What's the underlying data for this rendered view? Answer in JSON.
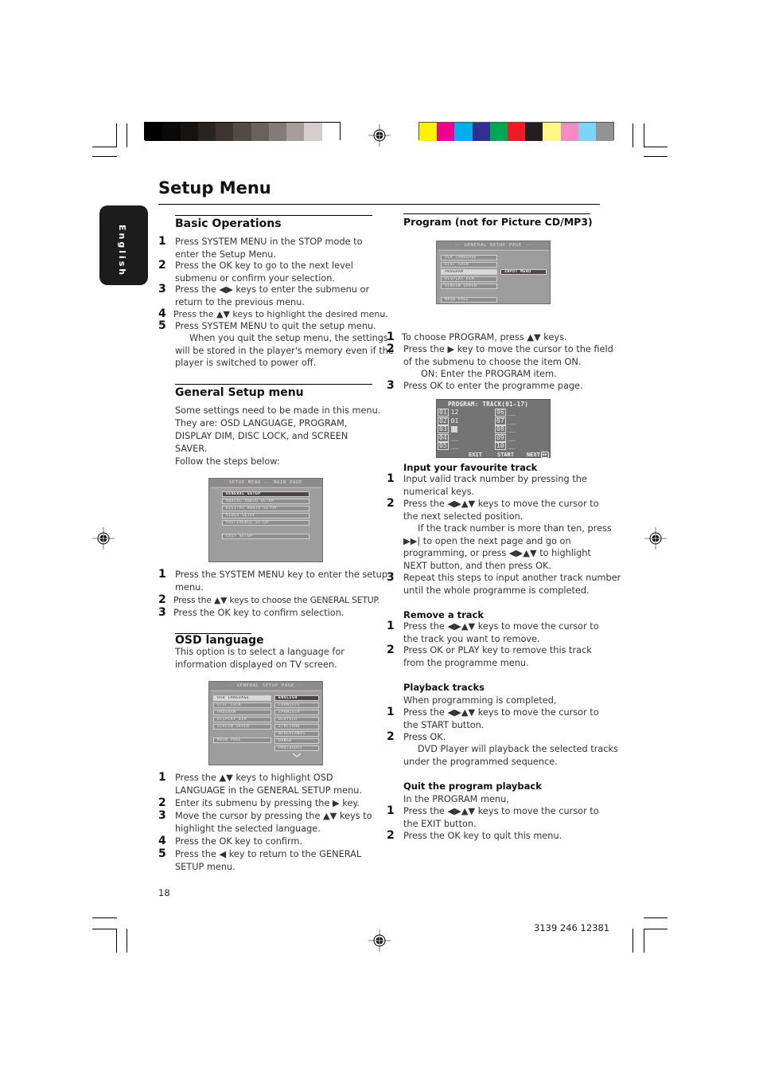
{
  "print_marks": {
    "gray_swatches": [
      "#000000",
      "#0b0907",
      "#161210",
      "#2a2421",
      "#3d3430",
      "#534a46",
      "#6b605c",
      "#847a76",
      "#a69c99",
      "#d5cdcb",
      "#ffffff"
    ],
    "color_swatches": [
      "#fff200",
      "#ec008c",
      "#00aeef",
      "#2e3192",
      "#00a651",
      "#ed1c24",
      "#231f20",
      "#fff685",
      "#f58ac5",
      "#7dd4f7",
      "#939393"
    ]
  },
  "side_tab": {
    "label": "English"
  },
  "page_title": "Setup Menu",
  "basic_operations": {
    "heading": "Basic Operations",
    "steps": [
      {
        "n": "1",
        "lines": [
          "Press SYSTEM MENU in the STOP mode to",
          "enter the Setup Menu."
        ]
      },
      {
        "n": "2",
        "lines": [
          "Press the OK key to go to the next level",
          "submenu or confirm your selection."
        ]
      },
      {
        "n": "3",
        "lines": [
          "Press the ◀▶ keys to enter the submenu or",
          "return to the previous menu."
        ]
      },
      {
        "n": "4",
        "lines": [
          "Press the ▲▼ keys to highlight the desired menu."
        ]
      },
      {
        "n": "5",
        "lines": [
          "Press SYSTEM MENU to quit the setup menu."
        ]
      }
    ],
    "note_lines": [
      "When you quit the setup menu, the settings",
      "will be stored in the player's memory even if the",
      "player is switched to power off."
    ]
  },
  "general_setup": {
    "heading": "General Setup menu",
    "intro_lines": [
      "Some settings need to be made in this menu.",
      "They are: OSD LANGUAGE, PROGRAM,",
      "DISPLAY DIM, DISC LOCK, and SCREEN",
      "SAVER.",
      "Follow the steps below:"
    ],
    "screen": {
      "header": "SETUP MENU -- MAIN PAGE",
      "items": [
        "GENERAL SETUP",
        "ANALOG AUDIO SETUP",
        "DIGITAL AUDIO SETUP",
        "VIDEO SETUP",
        "PREFERENCE SETUP"
      ],
      "exit": "EXIT SETUP"
    },
    "steps": [
      {
        "n": "1",
        "lines": [
          "Press the SYSTEM MENU key to enter the setup",
          "menu."
        ]
      },
      {
        "n": "2",
        "lines": [
          "Press the ▲▼ keys to choose the GENERAL SETUP."
        ]
      },
      {
        "n": "3",
        "lines": [
          "Press the OK key to confirm selection."
        ]
      }
    ]
  },
  "osd_language": {
    "heading": "OSD language",
    "intro_lines": [
      "This option is to select a language for",
      "information displayed on TV screen."
    ],
    "screen": {
      "header": "-- GENERAL SETUP PAGE --",
      "left_items": [
        "OSD LANGUAGE",
        "DISC LOCK",
        "PROGRAM",
        "DISPLAY DIM",
        "SCREEN SAVER"
      ],
      "main_page": "MAIN PAGE",
      "right_items": [
        "ENGLISH",
        "FRANÇAIS",
        "SPANISCH",
        "DEUTSCH",
        "ITALIANO",
        "NEDERLANDS",
        "DANSK",
        "PORTUGUES"
      ]
    },
    "steps": [
      {
        "n": "1",
        "lines": [
          "Press the ▲▼ keys to highlight OSD",
          "LANGUAGE in the GENERAL SETUP menu."
        ]
      },
      {
        "n": "2",
        "lines": [
          "Enter its submenu by pressing the ▶  key."
        ]
      },
      {
        "n": "3",
        "lines": [
          "Move the cursor by pressing the ▲▼ keys to",
          "highlight the selected language."
        ]
      },
      {
        "n": "4",
        "lines": [
          "Press the OK key to confirm."
        ]
      },
      {
        "n": "5",
        "lines": [
          "Press the ◀ key to return to the GENERAL",
          "SETUP menu."
        ]
      }
    ]
  },
  "program": {
    "heading": "Program (not for Picture CD/MP3)",
    "screen": {
      "header": "-- GENERAL SETUP PAGE --",
      "left_items": [
        "OSD LANGUAGE",
        "DISC LOCK",
        "PROGRAM",
        "DISPLAY DIM",
        "SCREEN SAVER"
      ],
      "main_page": "MAIN PAGE",
      "submenu": "INPUT MENU"
    },
    "steps": [
      {
        "n": "1",
        "lines": [
          "To choose PROGRAM, press ▲▼ keys."
        ]
      },
      {
        "n": "2",
        "lines": [
          "Press the ▶ key to move the cursor to the field",
          "of the submenu to choose the item ON."
        ]
      },
      {
        "n": "3",
        "lines": [
          "Press OK to enter the programme page."
        ]
      }
    ],
    "on_note": "ON: Enter the PROGRAM item.",
    "program_screen": {
      "header": "PROGRAM:  TRACK(01-17)",
      "slots": [
        {
          "n": "01",
          "v": "12"
        },
        {
          "n": "02",
          "v": "01"
        },
        {
          "n": "03",
          "v": ""
        },
        {
          "n": "04",
          "v": "__"
        },
        {
          "n": "05",
          "v": "__"
        },
        {
          "n": "06",
          "v": "__"
        },
        {
          "n": "07",
          "v": "__"
        },
        {
          "n": "08",
          "v": "__"
        },
        {
          "n": "09",
          "v": "__"
        },
        {
          "n": "10",
          "v": "__"
        }
      ],
      "exit": "EXIT",
      "start": "START",
      "next": "NEXT"
    }
  },
  "input_track": {
    "heading": "Input your favourite track",
    "steps": [
      {
        "n": "1",
        "lines": [
          "Input valid track number by pressing the",
          "numerical keys."
        ]
      },
      {
        "n": "2",
        "lines": [
          "Press the ◀▶▲▼ keys to move the cursor to",
          "the next selected position."
        ]
      },
      {
        "n": "3",
        "lines": [
          "Repeat this steps to input another track number",
          "until the whole programme is completed."
        ]
      }
    ],
    "note_lines": [
      "If the track number is more than ten, press",
      "▶▶| to open the next page and go on",
      "programming, or press ◀▶▲▼ to highlight",
      "NEXT button, and then press OK."
    ]
  },
  "remove_track": {
    "heading": "Remove a track",
    "steps": [
      {
        "n": "1",
        "lines": [
          "Press the ◀▶▲▼ keys to move the cursor to",
          "the track you want to remove."
        ]
      },
      {
        "n": "2",
        "lines": [
          "Press OK or PLAY key to remove this track",
          "from the programme menu."
        ]
      }
    ]
  },
  "playback_tracks": {
    "heading": "Playback tracks",
    "intro": "When programming is completed,",
    "steps": [
      {
        "n": "1",
        "lines": [
          "Press the ◀▶▲▼ keys to move the cursor to",
          "the START button."
        ]
      },
      {
        "n": "2",
        "lines": [
          "Press OK."
        ]
      }
    ],
    "note_lines": [
      "DVD Player will playback the selected tracks",
      "under the programmed sequence."
    ]
  },
  "quit_playback": {
    "heading": "Quit the program playback",
    "intro": "In the PROGRAM menu,",
    "steps": [
      {
        "n": "1",
        "lines": [
          "Press the ◀▶▲▼ keys to move the cursor to",
          "the EXIT button."
        ]
      },
      {
        "n": "2",
        "lines": [
          "Press the OK key to quit this menu."
        ]
      }
    ]
  },
  "footer": {
    "page_number": "18",
    "doc_code": "3139 246 12381"
  }
}
